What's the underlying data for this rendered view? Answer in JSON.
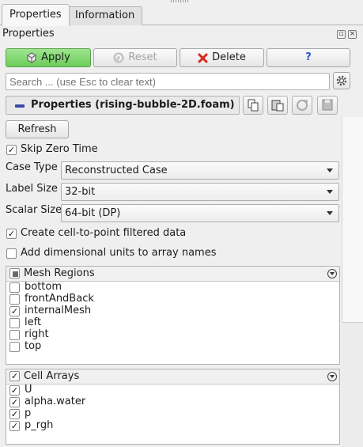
{
  "tabs": [
    {
      "label": "Properties",
      "active": true
    },
    {
      "label": "Information",
      "active": false
    }
  ],
  "panel": {
    "title": "Properties"
  },
  "toolbar": {
    "apply": "Apply",
    "reset": "Reset",
    "delete": "Delete",
    "help": "?"
  },
  "search": {
    "placeholder": "Search ... (use Esc to clear text)"
  },
  "properties_header": {
    "title": "Properties (rising-bubble-2D.foam)"
  },
  "refresh": "Refresh",
  "skip_zero_time": {
    "label": "Skip Zero Time",
    "checked": true
  },
  "case_type": {
    "label": "Case Type",
    "value": "Reconstructed Case"
  },
  "label_size": {
    "label": "Label Size",
    "value": "32-bit"
  },
  "scalar_size": {
    "label": "Scalar Size",
    "value": "64-bit (DP)"
  },
  "create_cell_to_point": {
    "label": "Create cell-to-point filtered data",
    "checked": true
  },
  "add_dimensional_units": {
    "label": "Add dimensional units to array names",
    "checked": false
  },
  "mesh_regions": {
    "title": "Mesh Regions",
    "items": [
      {
        "label": "bottom",
        "checked": false
      },
      {
        "label": "frontAndBack",
        "checked": false
      },
      {
        "label": "internalMesh",
        "checked": true
      },
      {
        "label": "left",
        "checked": false
      },
      {
        "label": "right",
        "checked": false
      },
      {
        "label": "top",
        "checked": false
      }
    ]
  },
  "cell_arrays": {
    "title": "Cell Arrays",
    "items": [
      {
        "label": "U",
        "checked": true
      },
      {
        "label": "alpha.water",
        "checked": true
      },
      {
        "label": "p",
        "checked": true
      },
      {
        "label": "p_rgh",
        "checked": true
      }
    ]
  },
  "colors": {
    "apply_green": "#7fd86c",
    "delete_red": "#d9261c",
    "help_blue": "#2f56c8",
    "header_icon": "#3e4aa8"
  }
}
